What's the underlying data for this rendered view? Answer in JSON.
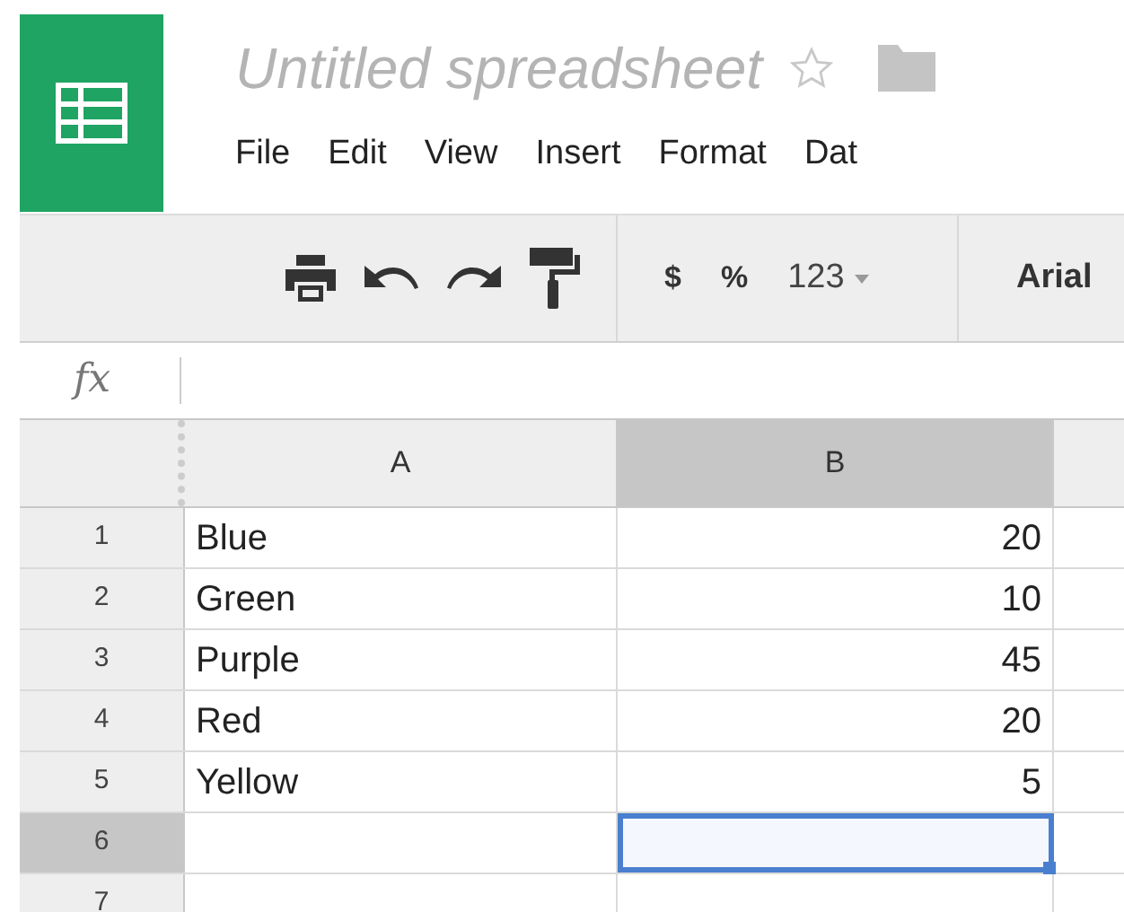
{
  "document": {
    "title": "Untitled spreadsheet"
  },
  "menu": [
    "File",
    "Edit",
    "View",
    "Insert",
    "Format",
    "Dat"
  ],
  "toolbar": {
    "buttons": [
      {
        "kind": "print"
      },
      {
        "kind": "undo"
      },
      {
        "kind": "redo"
      },
      {
        "kind": "paint"
      }
    ],
    "formats": [
      "$",
      "%",
      "123"
    ],
    "font": "Arial"
  },
  "formula_bar": {
    "label": "fx"
  },
  "columns": [
    {
      "label": "A",
      "selected": false
    },
    {
      "label": "B",
      "selected": true
    }
  ],
  "rows": [
    {
      "number": "1",
      "selected": false,
      "cells": [
        {
          "text": "Blue",
          "selected": false
        },
        {
          "text": "20",
          "selected": false
        }
      ]
    },
    {
      "number": "2",
      "selected": false,
      "cells": [
        {
          "text": "Green",
          "selected": false
        },
        {
          "text": "10",
          "selected": false
        }
      ]
    },
    {
      "number": "3",
      "selected": false,
      "cells": [
        {
          "text": "Purple",
          "selected": false
        },
        {
          "text": "45",
          "selected": false
        }
      ]
    },
    {
      "number": "4",
      "selected": false,
      "cells": [
        {
          "text": "Red",
          "selected": false
        },
        {
          "text": "20",
          "selected": false
        }
      ]
    },
    {
      "number": "5",
      "selected": false,
      "cells": [
        {
          "text": "Yellow",
          "selected": false
        },
        {
          "text": "5",
          "selected": false
        }
      ]
    },
    {
      "number": "6",
      "selected": true,
      "cells": [
        {
          "selected": false
        },
        {
          "selected": true
        }
      ]
    },
    {
      "number": "7",
      "selected": false,
      "cells": [
        {
          "selected": false
        },
        {
          "selected": false
        }
      ]
    }
  ]
}
